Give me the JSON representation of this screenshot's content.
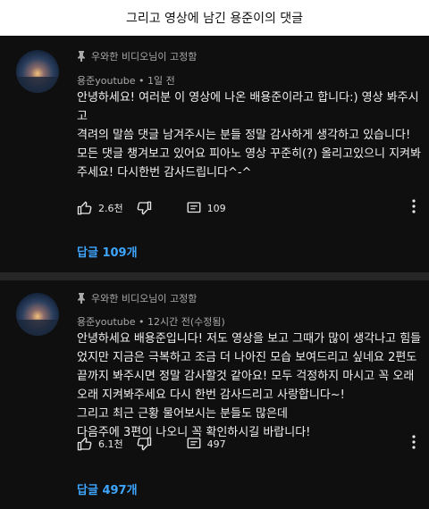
{
  "header_title": "그리고 영상에 남긴 용준이의 댓글",
  "comments": [
    {
      "pinned_label": "우와한 비디오님이 고정함",
      "author": "용준youtube",
      "separator": "•",
      "time": "1일 전",
      "text": "안녕하세요! 여러분 이 영상에 나온 배용준이라고 합니다:) 영상 봐주시고\n격려의 말씀 댓글 남겨주시는 분들 정말 감사하게 생각하고 있습니다!\n모든 댓글 챙겨보고 있어요 피아노 영상 꾸준히(?) 올리고있으니 지켜봐주세요! 다시한번 감사드립니다^-^",
      "likes": "2.6천",
      "replies_count": "109",
      "reply_link": "답글 109개"
    },
    {
      "pinned_label": "우와한 비디오님이 고정함",
      "author": "용준youtube",
      "separator": "•",
      "time": "12시간 전(수정됨)",
      "text": "안녕하세요 배용준입니다! 저도 영상을 보고 그때가 많이 생각나고 힘들었지만 지금은 극복하고 조금 더 나아진 모습 보여드리고 싶네요 2편도 끝까지 봐주시면 정말 감사할것 같아요! 모두 걱정하지 마시고 꼭 오래오래 지켜봐주세요 다시 한번 감사드리고 사랑합니다~!\n그리고 최근 근황 물어보시는 분들도 많은데\n다음주에 3편이 나오니 꼭 확인하시길 바랍니다!",
      "likes": "6.1천",
      "replies_count": "497",
      "reply_link": "답글 497개"
    }
  ],
  "colors": {
    "background": "#0f0f0f",
    "text": "#f1f1f1",
    "muted": "#aaaaaa",
    "link": "#3ea6ff"
  },
  "icons": [
    "pin-icon",
    "thumbs-up-icon",
    "thumbs-down-icon",
    "reply-icon",
    "more-vert-icon"
  ]
}
